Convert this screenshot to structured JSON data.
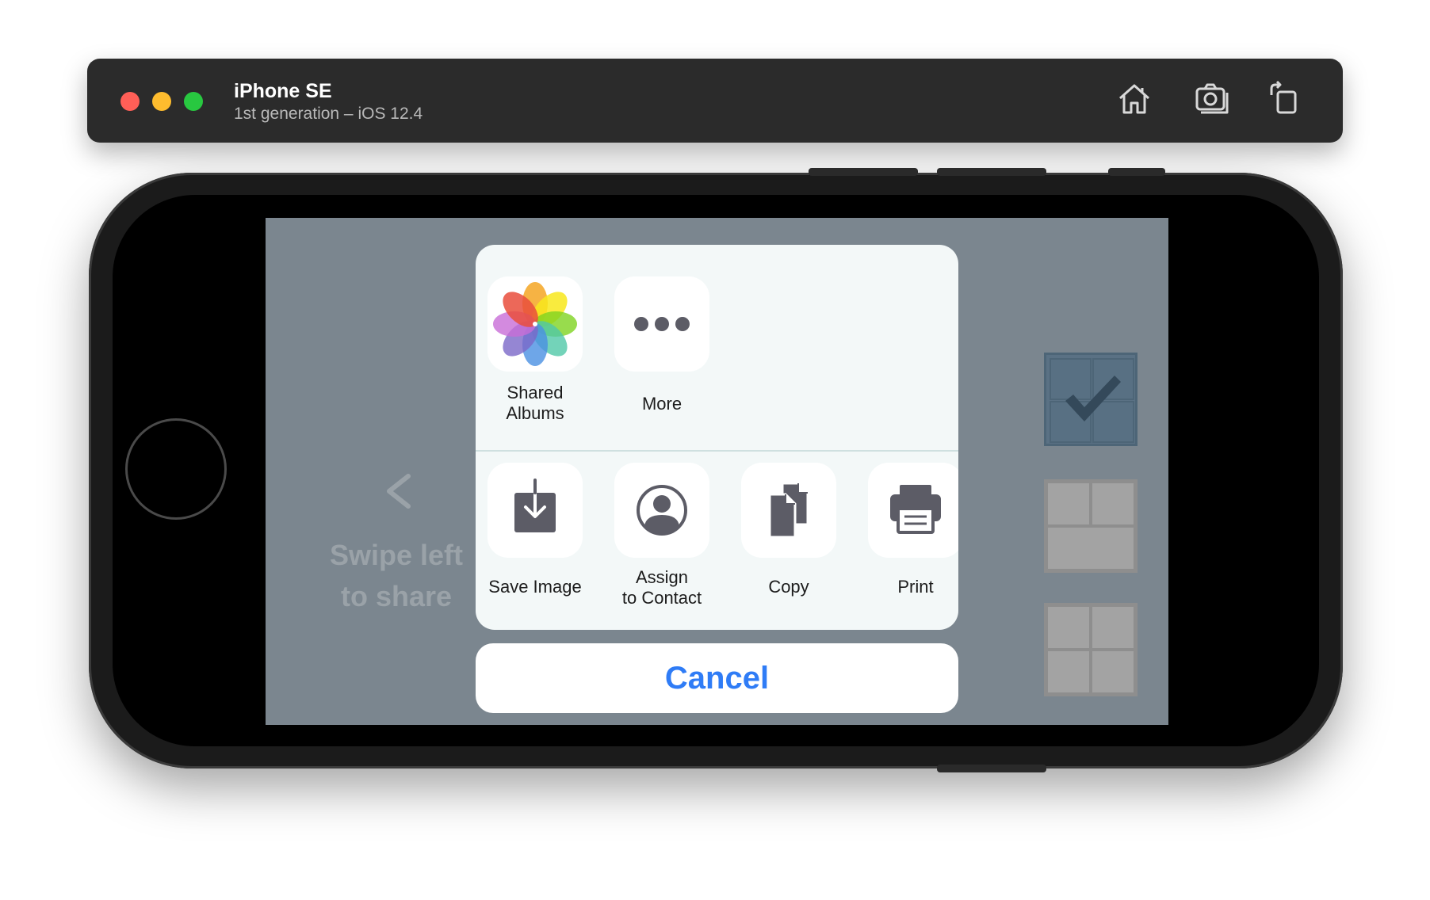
{
  "simulator": {
    "device_name": "iPhone SE",
    "device_subtitle": "1st generation – iOS 12.4",
    "buttons": [
      "home-icon",
      "screenshot-icon",
      "rotate-icon"
    ]
  },
  "app": {
    "hint_text": "Swipe left\nto share",
    "hint_icon": "chevron-left-icon",
    "layout_options": [
      "layout-grid-selected",
      "layout-2-top-1-bottom",
      "layout-2x2"
    ]
  },
  "share_sheet": {
    "apps": [
      {
        "label": "Shared\nAlbums",
        "icon": "photos-icon"
      },
      {
        "label": "More",
        "icon": "more-icon"
      }
    ],
    "actions": [
      {
        "label": "Save Image",
        "icon": "save-image-icon"
      },
      {
        "label": "Assign\nto Contact",
        "icon": "contact-icon"
      },
      {
        "label": "Copy",
        "icon": "copy-icon"
      },
      {
        "label": "Print",
        "icon": "print-icon"
      }
    ],
    "cancel_label": "Cancel"
  },
  "colors": {
    "accent": "#2f7cf6",
    "screen_background": "#7b868f",
    "sheet_background": "#f3f8f8",
    "selected_layout": "#5a7184"
  }
}
